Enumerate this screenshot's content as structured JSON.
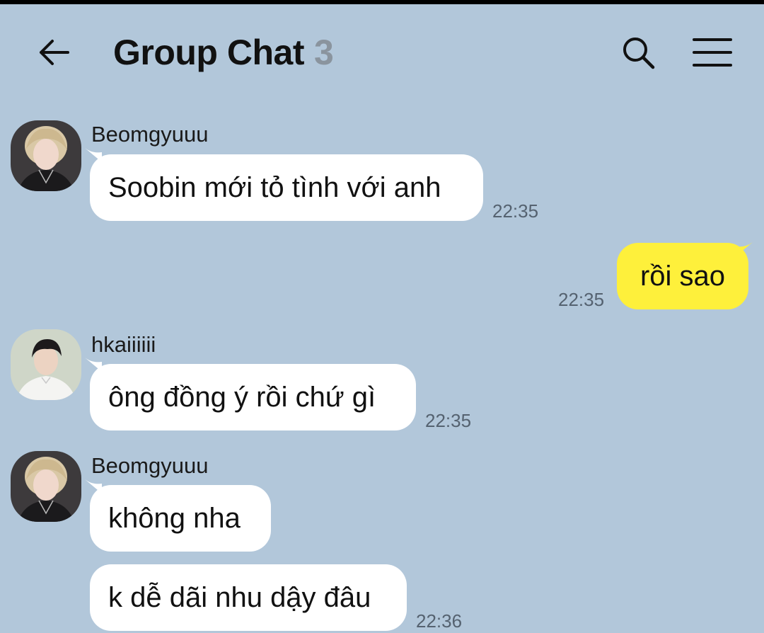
{
  "header": {
    "back_icon": "arrow-left-icon",
    "title": "Group Chat",
    "member_count": "3",
    "search_icon": "search-icon",
    "menu_icon": "hamburger-menu-icon"
  },
  "colors": {
    "background": "#b2c7da",
    "incoming_bubble": "#ffffff",
    "outgoing_bubble": "#fef03b",
    "timestamp": "#556270"
  },
  "messages": [
    {
      "sender": "Beomgyuuu",
      "text": "Soobin mới tỏ tình với anh",
      "time": "22:35",
      "direction": "incoming"
    },
    {
      "text": "rồi sao",
      "time": "22:35",
      "direction": "outgoing"
    },
    {
      "sender": "hkaiiiiii",
      "text": "ông đồng ý rồi chứ gì",
      "time": "22:35",
      "direction": "incoming"
    },
    {
      "sender": "Beomgyuuu",
      "text": "không nha",
      "direction": "incoming"
    },
    {
      "text": "k dễ dãi nhu dậy đâu",
      "time": "22:36",
      "direction": "incoming"
    }
  ]
}
